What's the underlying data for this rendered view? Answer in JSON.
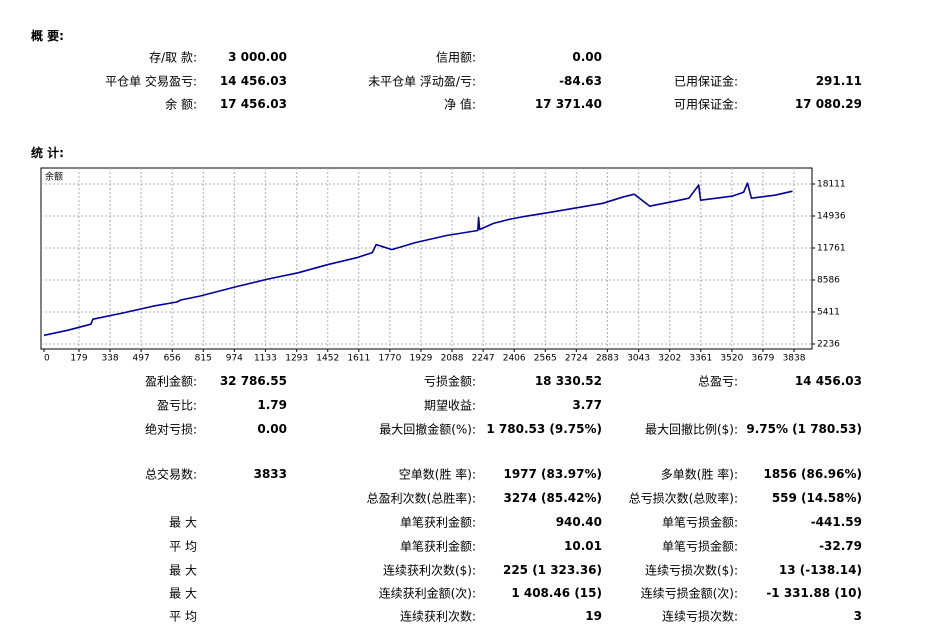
{
  "summary": {
    "title": "概 要:",
    "rows": [
      {
        "l1": "存/取 款:",
        "v1": "3 000.00",
        "l2": "信用额:",
        "v2": "0.00",
        "l3": "",
        "v3": ""
      },
      {
        "l1": "平仓单 交易盈亏:",
        "v1": "14 456.03",
        "l2": "未平仓单 浮动盈/亏:",
        "v2": "-84.63",
        "l3": "已用保证金:",
        "v3": "291.11"
      },
      {
        "l1": "余 额:",
        "v1": "17 456.03",
        "l2": "净 值:",
        "v2": "17 371.40",
        "l3": "可用保证金:",
        "v3": "17 080.29"
      }
    ]
  },
  "stats": {
    "title": "统 计:",
    "rows": [
      {
        "l1": "盈利金额:",
        "v1": "32 786.55",
        "l2": "亏损金额:",
        "v2": "18 330.52",
        "l3": "总盈亏:",
        "v3": "14 456.03"
      },
      {
        "l1": "盈亏比:",
        "v1": "1.79",
        "l2": "期望收益:",
        "v2": "3.77",
        "l3": "",
        "v3": ""
      },
      {
        "l1": "绝对亏损:",
        "v1": "0.00",
        "l2": "最大回撤金额(%):",
        "v2": "1 780.53 (9.75%)",
        "l3": "最大回撤比例($):",
        "v3": "9.75% (1 780.53)"
      },
      {
        "l1": "总交易数:",
        "v1": "3833",
        "l2": "空单数(胜 率):",
        "v2": "1977 (83.97%)",
        "l3": "多单数(胜 率):",
        "v3": "1856 (86.96%)"
      },
      {
        "l1": "",
        "v1": "",
        "l2": "总盈利次数(总胜率):",
        "v2": "3274 (85.42%)",
        "l3": "总亏损次数(总败率):",
        "v3": "559 (14.58%)"
      },
      {
        "l1": "最 大",
        "v1": "",
        "l2": "单笔获利金额:",
        "v2": "940.40",
        "l3": "单笔亏损金额:",
        "v3": "-441.59"
      },
      {
        "l1": "平 均",
        "v1": "",
        "l2": "单笔获利金额:",
        "v2": "10.01",
        "l3": "单笔亏损金额:",
        "v3": "-32.79"
      },
      {
        "l1": "最 大",
        "v1": "",
        "l2": "连续获利次数($):",
        "v2": "225 (1 323.36)",
        "l3": "连续亏损次数($):",
        "v3": "13 (-138.14)"
      },
      {
        "l1": "最 大",
        "v1": "",
        "l2": "连续获利金额(次):",
        "v2": "1 408.46 (15)",
        "l3": "连续亏损金额(次):",
        "v3": "-1 331.88 (10)"
      },
      {
        "l1": "平 均",
        "v1": "",
        "l2": "连续获利次数:",
        "v2": "19",
        "l3": "连续亏损次数:",
        "v3": "3"
      }
    ]
  },
  "chart_data": {
    "type": "line",
    "title": "余额",
    "x_ticks": [
      "0",
      "179",
      "338",
      "497",
      "656",
      "815",
      "974",
      "1133",
      "1293",
      "1452",
      "1611",
      "1770",
      "1929",
      "2088",
      "2247",
      "2406",
      "2565",
      "2724",
      "2883",
      "3043",
      "3202",
      "3361",
      "3520",
      "3679",
      "3838"
    ],
    "y_ticks": [
      "18111",
      "14936",
      "11761",
      "8586",
      "5411",
      "2236"
    ],
    "xlim": [
      0,
      3930
    ],
    "ylim": [
      2236,
      18111
    ],
    "grid": true,
    "series": [
      {
        "color": "#0000a0",
        "x": [
          0,
          120,
          240,
          250,
          400,
          560,
          680,
          700,
          800,
          980,
          1150,
          1300,
          1450,
          1600,
          1680,
          1700,
          1780,
          1900,
          2060,
          2220,
          2224,
          2229,
          2300,
          2380,
          2460,
          2590,
          2740,
          2860,
          2960,
          3020,
          3100,
          3120,
          3200,
          3300,
          3350,
          3360,
          3520,
          3580,
          3600,
          3620,
          3740,
          3830
        ],
        "y": [
          3100,
          3600,
          4200,
          4700,
          5300,
          6000,
          6400,
          6600,
          7000,
          7900,
          8700,
          9300,
          10100,
          10800,
          11300,
          12100,
          11600,
          12300,
          13000,
          13500,
          14800,
          13600,
          14200,
          14600,
          14900,
          15300,
          15800,
          16200,
          16800,
          17100,
          15900,
          16000,
          16300,
          16700,
          18000,
          16500,
          16900,
          17300,
          18200,
          16700,
          17000,
          17400
        ]
      }
    ],
    "line_color": "#0000a0"
  }
}
